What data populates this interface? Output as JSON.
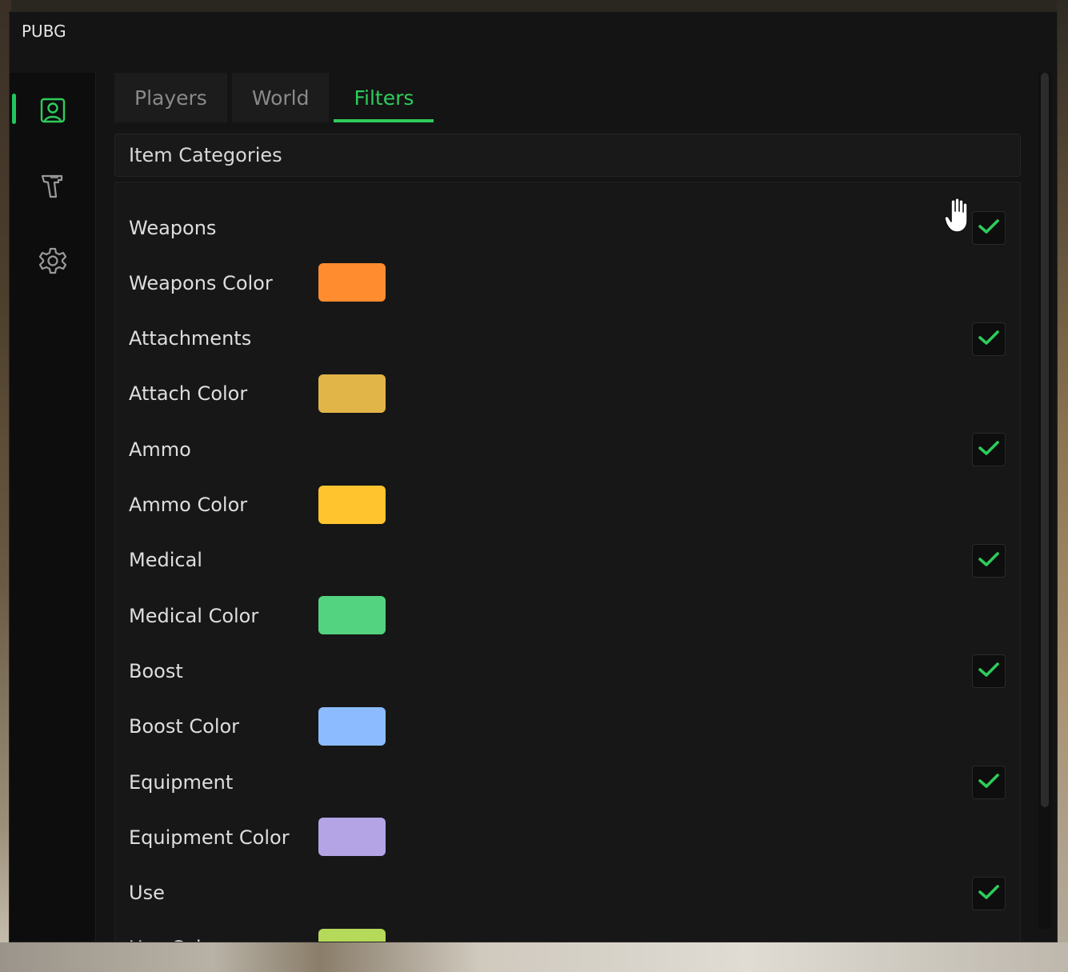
{
  "window": {
    "title": "PUBG"
  },
  "sidebar": {
    "items": [
      {
        "icon": "player-icon",
        "active": true
      },
      {
        "icon": "gun-icon",
        "active": false
      },
      {
        "icon": "gear-icon",
        "active": false
      }
    ]
  },
  "tabs": [
    {
      "label": "Players",
      "active": false
    },
    {
      "label": "World",
      "active": false
    },
    {
      "label": "Filters",
      "active": true
    }
  ],
  "section": {
    "title": "Item Categories"
  },
  "rows": [
    {
      "label": "Weapons",
      "type": "toggle",
      "checked": true
    },
    {
      "label": "Weapons Color",
      "type": "color",
      "color": "#ff8c2f"
    },
    {
      "label": "Attachments",
      "type": "toggle",
      "checked": true
    },
    {
      "label": "Attach Color",
      "type": "color",
      "color": "#e2b548"
    },
    {
      "label": "Ammo",
      "type": "toggle",
      "checked": true
    },
    {
      "label": "Ammo Color",
      "type": "color",
      "color": "#ffc42e"
    },
    {
      "label": "Medical",
      "type": "toggle",
      "checked": true
    },
    {
      "label": "Medical Color",
      "type": "color",
      "color": "#53d37f"
    },
    {
      "label": "Boost",
      "type": "toggle",
      "checked": true
    },
    {
      "label": "Boost Color",
      "type": "color",
      "color": "#8cbcff"
    },
    {
      "label": "Equipment",
      "type": "toggle",
      "checked": true
    },
    {
      "label": "Equipment Color",
      "type": "color",
      "color": "#b4a3e5"
    },
    {
      "label": "Use",
      "type": "toggle",
      "checked": true
    },
    {
      "label": "Use Color",
      "type": "color",
      "color": "#b5d959"
    }
  ],
  "colors": {
    "accent": "#2ecc5b",
    "window_bg": "#141414"
  }
}
